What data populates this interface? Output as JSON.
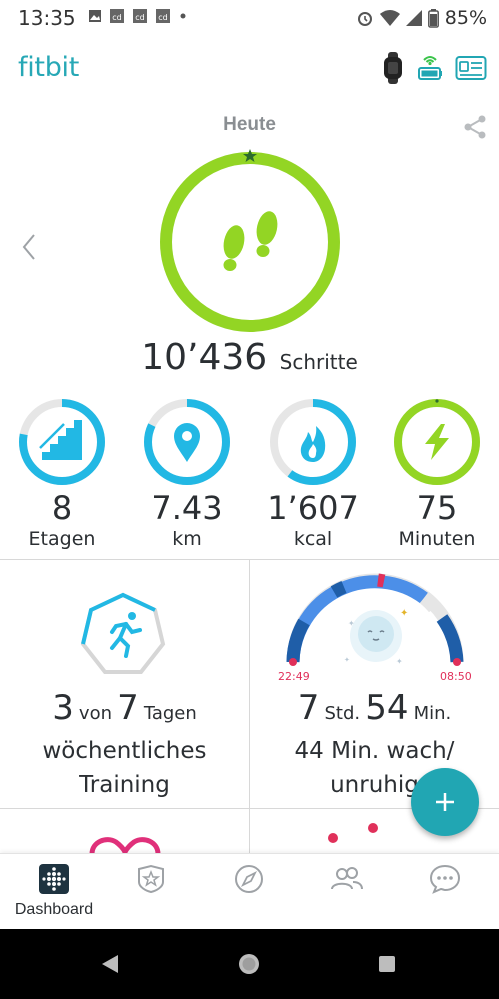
{
  "status_bar": {
    "time": "13:35",
    "battery": "85%",
    "icons": [
      "image-icon",
      "cd-app-icon",
      "cd-app-icon",
      "cd-app-icon",
      "dot-icon",
      "alarm-icon",
      "wifi-icon",
      "signal-icon",
      "battery-icon"
    ]
  },
  "header": {
    "logo": "fitbit",
    "icons": [
      "tracker-device-icon",
      "sync-battery-icon",
      "profile-card-icon"
    ]
  },
  "today": {
    "title": "Heute",
    "steps_value": "10’436",
    "steps_unit": "Schritte",
    "steps_progress": 1.0
  },
  "stats": [
    {
      "value": "8",
      "label": "Etagen",
      "icon": "stairs-icon",
      "progress": 0.78
    },
    {
      "value": "7.43",
      "label": "km",
      "icon": "location-pin-icon",
      "progress": 0.82
    },
    {
      "value": "1’607",
      "label": "kcal",
      "icon": "flame-icon",
      "progress": 0.6
    },
    {
      "value": "75",
      "label": "Minuten",
      "icon": "lightning-icon",
      "progress": 1.0
    }
  ],
  "exercise_tile": {
    "count": "3",
    "of_text": "von",
    "total": "7",
    "days_text": "Tagen",
    "label_line1": "wöchentliches",
    "label_line2": "Training"
  },
  "sleep_tile": {
    "start_time": "22:49",
    "end_time": "08:50",
    "hours": "7",
    "hours_unit": "Std.",
    "minutes": "54",
    "minutes_unit": "Min.",
    "awake_line1": "44 Min. wach/",
    "awake_line2": "unruhig"
  },
  "bottom_nav": {
    "items": [
      {
        "label": "Dashboard",
        "icon": "dashboard-icon",
        "active": true
      },
      {
        "label": "",
        "icon": "challenges-badge-icon"
      },
      {
        "label": "",
        "icon": "discover-compass-icon"
      },
      {
        "label": "",
        "icon": "community-icon"
      },
      {
        "label": "",
        "icon": "chat-icon"
      }
    ]
  },
  "colors": {
    "accent_teal": "#21a6b3",
    "green": "#93d524",
    "blue_ring": "#22b8e4",
    "sleep_dark": "#1f5ea8",
    "sleep_pink": "#e0305a"
  }
}
